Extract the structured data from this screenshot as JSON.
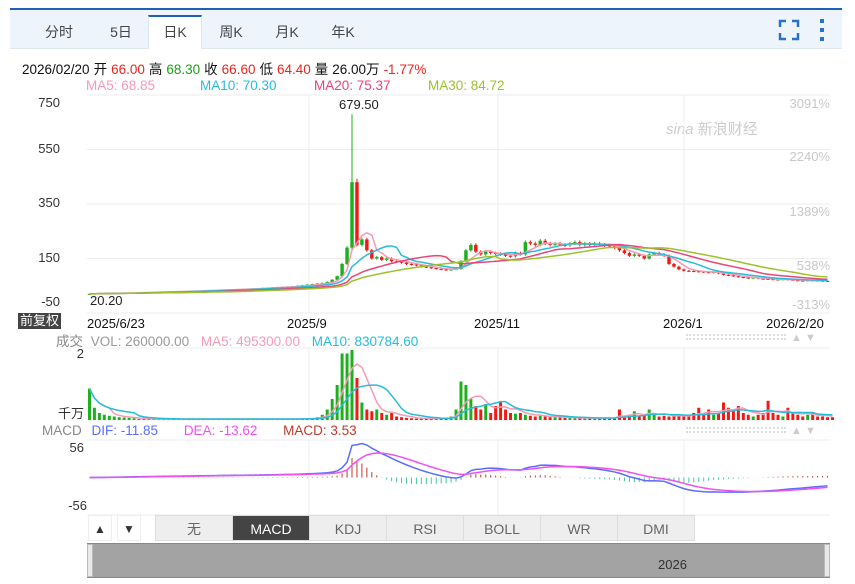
{
  "tabs": [
    {
      "label": "分时"
    },
    {
      "label": "5日"
    },
    {
      "label": "日K"
    },
    {
      "label": "周K"
    },
    {
      "label": "月K"
    },
    {
      "label": "年K"
    }
  ],
  "active_tab": "日K",
  "info": {
    "date": "2026/02/20",
    "open_label": "开",
    "open": "66.00",
    "high_label": "高",
    "high": "68.30",
    "close_label": "收",
    "close": "66.60",
    "low_label": "低",
    "low": "64.40",
    "vol_label": "量",
    "vol": "26.00万",
    "change": "-1.77%"
  },
  "ma": {
    "ma5": "MA5: 68.85",
    "ma10": "MA10: 70.30",
    "ma20": "MA20: 75.37",
    "ma30": "MA30: 84.72"
  },
  "colors": {
    "up": "#1db01d",
    "down": "#f01a14",
    "ma5": "#f59ab4",
    "ma10": "#26bcdc",
    "ma20": "#e9457a",
    "ma30": "#9bc22c",
    "dif": "#5a6dfa",
    "dea": "#f050f0",
    "macd_pos": "#c0392b",
    "macd_neg": "#3cc9a0"
  },
  "main": {
    "y_ticks": [
      "750",
      "550",
      "350",
      "150",
      "-50"
    ],
    "pct_ticks": [
      "3091%",
      "2240%",
      "1389%",
      "538%",
      "-313%"
    ],
    "max_label": "679.50",
    "min_label": "20.20",
    "x_ticks": [
      "2025/6/23",
      "2025/9",
      "2025/11",
      "2026/1",
      "2026/2/20"
    ],
    "fuquan": "前复权",
    "watermark": "sina 新浪财经"
  },
  "volume": {
    "title": "成交",
    "vol": "VOL: 260000.00",
    "ma5": "MA5: 495300.00",
    "ma10": "MA10: 830784.60",
    "y_top": "2",
    "unit": "千万"
  },
  "macd": {
    "title": "MACD",
    "dif": "DIF: -11.85",
    "dea": "DEA: -13.62",
    "macd": "MACD: 3.53",
    "y_top": "56",
    "y_bottom": "-56"
  },
  "indicators": [
    {
      "label": "无"
    },
    {
      "label": "MACD"
    },
    {
      "label": "KDJ"
    },
    {
      "label": "RSI"
    },
    {
      "label": "BOLL"
    },
    {
      "label": "WR"
    },
    {
      "label": "DMI"
    }
  ],
  "active_indicator": "MACD",
  "nav": {
    "label": "2026"
  },
  "chart_data": {
    "type": "candlestick",
    "y_range": [
      -50,
      750
    ],
    "closes": [
      20.2,
      21,
      21.5,
      22,
      22.5,
      23,
      23,
      24,
      24.5,
      25,
      25,
      26,
      26.5,
      27,
      27.5,
      28,
      28,
      29,
      29.5,
      30,
      31,
      31.5,
      32,
      33,
      33.5,
      34,
      35,
      35.5,
      36,
      37,
      37.5,
      38,
      39,
      40,
      41,
      42,
      43,
      44,
      45,
      46,
      47,
      48,
      50,
      52,
      54,
      56,
      58,
      60,
      64,
      72,
      85,
      130,
      190,
      430,
      200,
      220,
      180,
      150,
      155,
      145,
      150,
      140,
      138,
      135,
      130,
      128,
      125,
      120,
      118,
      115,
      112,
      110,
      108,
      110,
      112,
      140,
      180,
      200,
      175,
      165,
      175,
      170,
      168,
      165,
      160,
      158,
      170,
      165,
      210,
      205,
      200,
      215,
      205,
      200,
      205,
      200,
      198,
      205,
      210,
      200,
      205,
      200,
      205,
      200,
      198,
      195,
      190,
      180,
      170,
      160,
      165,
      160,
      150,
      165,
      170,
      165,
      160,
      130,
      120,
      110,
      105,
      104,
      103,
      102,
      100,
      98,
      100,
      95,
      90,
      88,
      85,
      82,
      80,
      78,
      80,
      76,
      75,
      74,
      73,
      72,
      74,
      72,
      70,
      69,
      68,
      70,
      69,
      68,
      67.8,
      66.6
    ],
    "spike": {
      "index": 53,
      "high": 679.5
    },
    "volume_qianwan": [
      0.9,
      0.35,
      0.2,
      0.15,
      0.12,
      0.1,
      0.08,
      0.07,
      0.06,
      0.05,
      0.03,
      0.03,
      0.03,
      0.03,
      0.03,
      0.03,
      0.03,
      0.03,
      0.03,
      0.03,
      0.03,
      0.03,
      0.03,
      0.03,
      0.03,
      0.03,
      0.03,
      0.03,
      0.03,
      0.03,
      0.03,
      0.03,
      0.03,
      0.03,
      0.03,
      0.03,
      0.03,
      0.03,
      0.03,
      0.03,
      0.03,
      0.03,
      0.03,
      0.04,
      0.04,
      0.05,
      0.08,
      0.15,
      0.3,
      0.6,
      1.0,
      1.9,
      1.9,
      2.0,
      1.2,
      0.5,
      0.3,
      0.25,
      0.3,
      0.2,
      0.15,
      0.2,
      0.1,
      0.08,
      0.06,
      0.05,
      0.04,
      0.04,
      0.04,
      0.04,
      0.04,
      0.05,
      0.05,
      0.1,
      0.3,
      1.1,
      1.0,
      0.6,
      0.4,
      0.3,
      0.45,
      0.2,
      0.4,
      0.5,
      0.3,
      0.2,
      0.18,
      0.2,
      0.15,
      0.12,
      0.1,
      0.12,
      0.1,
      0.08,
      0.08,
      0.07,
      0.07,
      0.06,
      0.06,
      0.05,
      0.05,
      0.05,
      0.05,
      0.05,
      0.06,
      0.06,
      0.06,
      0.3,
      0.1,
      0.15,
      0.25,
      0.1,
      0.15,
      0.3,
      0.15,
      0.1,
      0.12,
      0.1,
      0.12,
      0.15,
      0.1,
      0.1,
      0.2,
      0.35,
      0.2,
      0.3,
      0.15,
      0.2,
      0.5,
      0.35,
      0.25,
      0.4,
      0.2,
      0.15,
      0.1,
      0.15,
      0.2,
      0.55,
      0.2,
      0.15,
      0.1,
      0.35,
      0.2,
      0.15,
      0.1,
      0.15,
      0.2,
      0.1,
      0.1,
      0.08,
      0.08
    ]
  }
}
